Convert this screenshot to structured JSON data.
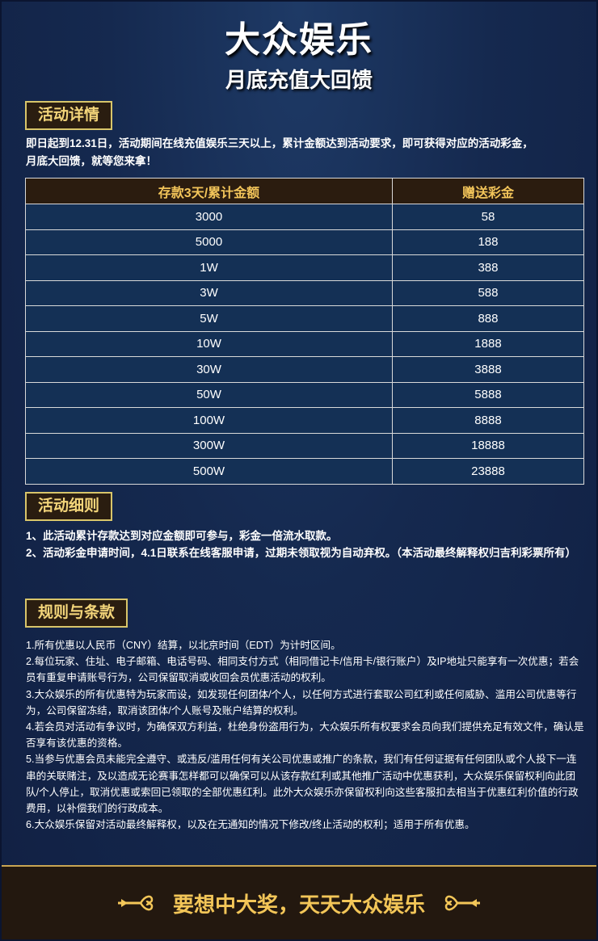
{
  "header": {
    "title": "大众娱乐",
    "subtitle": "月底充值大回馈"
  },
  "details": {
    "tag": "活动详情",
    "intro_line1": "即日起到12.31日，活动期间在线充值娱乐三天以上，累计金额达到活动要求，即可获得对应的活动彩金，",
    "intro_line2": "月底大回馈，就等您来拿！"
  },
  "table": {
    "headers": [
      "存款3天/累计金额",
      "赠送彩金"
    ],
    "rows": [
      [
        "3000",
        "58"
      ],
      [
        "5000",
        "188"
      ],
      [
        "1W",
        "388"
      ],
      [
        "3W",
        "588"
      ],
      [
        "5W",
        "888"
      ],
      [
        "10W",
        "1888"
      ],
      [
        "30W",
        "3888"
      ],
      [
        "50W",
        "5888"
      ],
      [
        "100W",
        "8888"
      ],
      [
        "300W",
        "18888"
      ],
      [
        "500W",
        "23888"
      ]
    ]
  },
  "terms": {
    "tag": "活动细则",
    "item1": "1、此活动累计存款达到对应金额即可参与，彩金一倍流水取款。",
    "item2": "2、活动彩金申请时间，4.1日联系在线客服申请，过期未领取视为自动弃权。（本活动最终解释权归吉利彩票所有）"
  },
  "rules": {
    "tag": "规则与条款",
    "items": [
      "1.所有优惠以人民币（CNY）结算，以北京时间（EDT）为计时区间。",
      "2.每位玩家、住址、电子邮箱、电话号码、相同支付方式（相同借记卡/信用卡/银行账户）及IP地址只能享有一次优惠；若会员有重复申请账号行为，公司保留取消或收回会员优惠活动的权利。",
      "3.大众娱乐的所有优惠特为玩家而设，如发现任何团体/个人，以任何方式进行套取公司红利或任何威胁、滥用公司优惠等行为，公司保留冻结，取消该团体/个人账号及账户结算的权利。",
      "4.若会员对活动有争议时，为确保双方利益，杜绝身份盗用行为，大众娱乐所有权要求会员向我们提供充足有效文件，确认是否享有该优惠的资格。",
      "5.当参与优惠会员未能完全遵守、或违反/滥用任何有关公司优惠或推广的条款，我们有任何证据有任何团队或个人投下一连串的关联赌注，及以造成无论赛事怎样都可以确保可以从该存款红利或其他推广活动中优惠获利，大众娱乐保留权利向此团队/个人停止，取消优惠或索回已领取的全部优惠红利。此外大众娱乐亦保留权利向这些客服扣去相当于优惠红利价值的行政费用，以补偿我们的行政成本。",
      "6.大众娱乐保留对活动最终解释权，以及在无通知的情况下修改/终止活动的权利；适用于所有优惠。"
    ]
  },
  "footer": {
    "slogan": "要想中大奖，天天大众娱乐",
    "left_ornament_icon": "flourish-left-icon",
    "right_ornament_icon": "flourish-right-icon"
  },
  "colors": {
    "background": "#15294f",
    "gold": "#f3c658",
    "tag_background": "#2a1d10",
    "table_header_background": "#2b1c0f"
  }
}
